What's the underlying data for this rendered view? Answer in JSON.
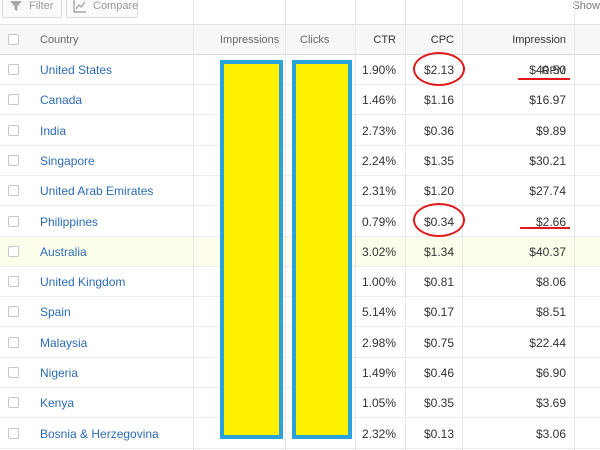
{
  "toolbar": {
    "filter_label": "Filter",
    "compare_label": "Compare",
    "show_label": "Show"
  },
  "table": {
    "headers": {
      "country": "Country",
      "impressions": "Impressions",
      "clicks": "Clicks",
      "ctr": "CTR",
      "cpc": "CPC",
      "rpm": "Impression RPM"
    },
    "rows": [
      {
        "country": "United States",
        "ctr": "1.90%",
        "cpc": "$2.13",
        "rpm": "$40.50"
      },
      {
        "country": "Canada",
        "ctr": "1.46%",
        "cpc": "$1.16",
        "rpm": "$16.97"
      },
      {
        "country": "India",
        "ctr": "2.73%",
        "cpc": "$0.36",
        "rpm": "$9.89"
      },
      {
        "country": "Singapore",
        "ctr": "2.24%",
        "cpc": "$1.35",
        "rpm": "$30.21"
      },
      {
        "country": "United Arab Emirates",
        "ctr": "2.31%",
        "cpc": "$1.20",
        "rpm": "$27.74"
      },
      {
        "country": "Philippines",
        "ctr": "0.79%",
        "cpc": "$0.34",
        "rpm": "$2.66"
      },
      {
        "country": "Australia",
        "ctr": "3.02%",
        "cpc": "$1.34",
        "rpm": "$40.37"
      },
      {
        "country": "United Kingdom",
        "ctr": "1.00%",
        "cpc": "$0.81",
        "rpm": "$8.06"
      },
      {
        "country": "Spain",
        "ctr": "5.14%",
        "cpc": "$0.17",
        "rpm": "$8.51"
      },
      {
        "country": "Malaysia",
        "ctr": "2.98%",
        "cpc": "$0.75",
        "rpm": "$22.44"
      },
      {
        "country": "Nigeria",
        "ctr": "1.49%",
        "cpc": "$0.46",
        "rpm": "$6.90"
      },
      {
        "country": "Kenya",
        "ctr": "1.05%",
        "cpc": "$0.35",
        "rpm": "$3.69"
      },
      {
        "country": "Bosnia & Herzegovina",
        "ctr": "2.32%",
        "cpc": "$0.13",
        "rpm": "$3.06"
      }
    ]
  },
  "colors": {
    "link": "#2d6cb4",
    "mask_fill": "#fff200",
    "mask_border": "#2aa2dc",
    "annotation": "#e01a1a",
    "highlight_row": "#fdfdec"
  }
}
